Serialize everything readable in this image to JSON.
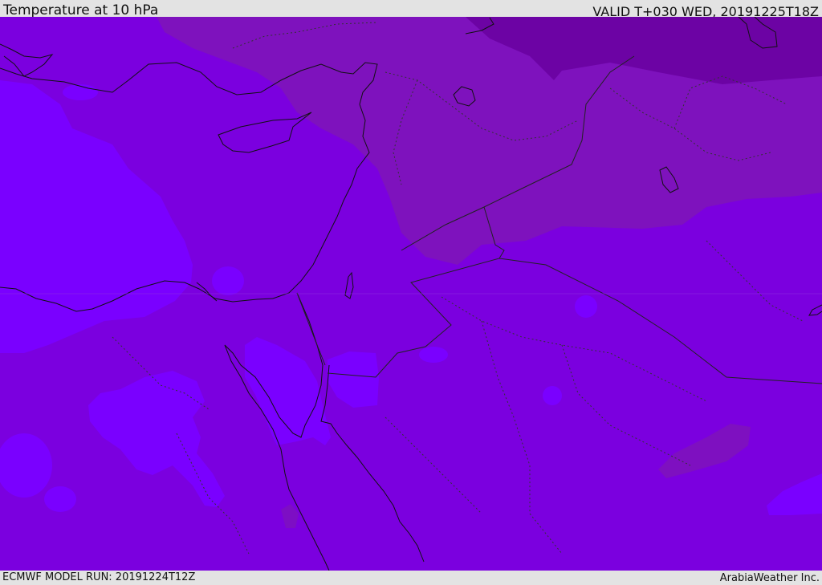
{
  "header": {
    "title": "Temperature at 10 hPa",
    "valid_time": "VALID T+030 WED, 20191225T18Z"
  },
  "footer": {
    "model_run": "ECMWF MODEL RUN: 20191224T12Z",
    "credit": "ArabiaWeather Inc."
  },
  "map": {
    "colors": {
      "base_fill": "#7b00df",
      "warm_band": "#7e12bd",
      "warmer_band": "#6c03a4",
      "cool_band": "#7a00ff",
      "coastline": "#111111",
      "border": "#222222"
    }
  }
}
